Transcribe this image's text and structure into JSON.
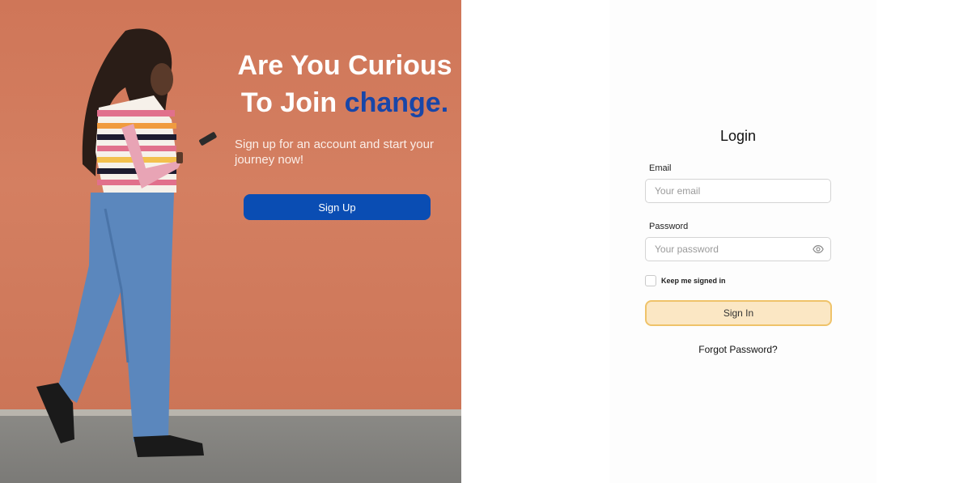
{
  "hero": {
    "headline_line1": "Are You Curious",
    "headline_line2_prefix": "To Join",
    "headline_accent": "change.",
    "subtitle": "Sign up for an account and start your journey now!",
    "signup_label": "Sign Up",
    "accent_color": "#1846a8"
  },
  "login": {
    "title": "Login",
    "email_label": "Email",
    "email_placeholder": "Your email",
    "password_label": "Password",
    "password_placeholder": "Your password",
    "password_toggle_icon": "eye-icon",
    "keep_signed_in_label": "Keep me signed in",
    "signin_label": "Sign In",
    "forgot_label": "Forgot Password?"
  }
}
